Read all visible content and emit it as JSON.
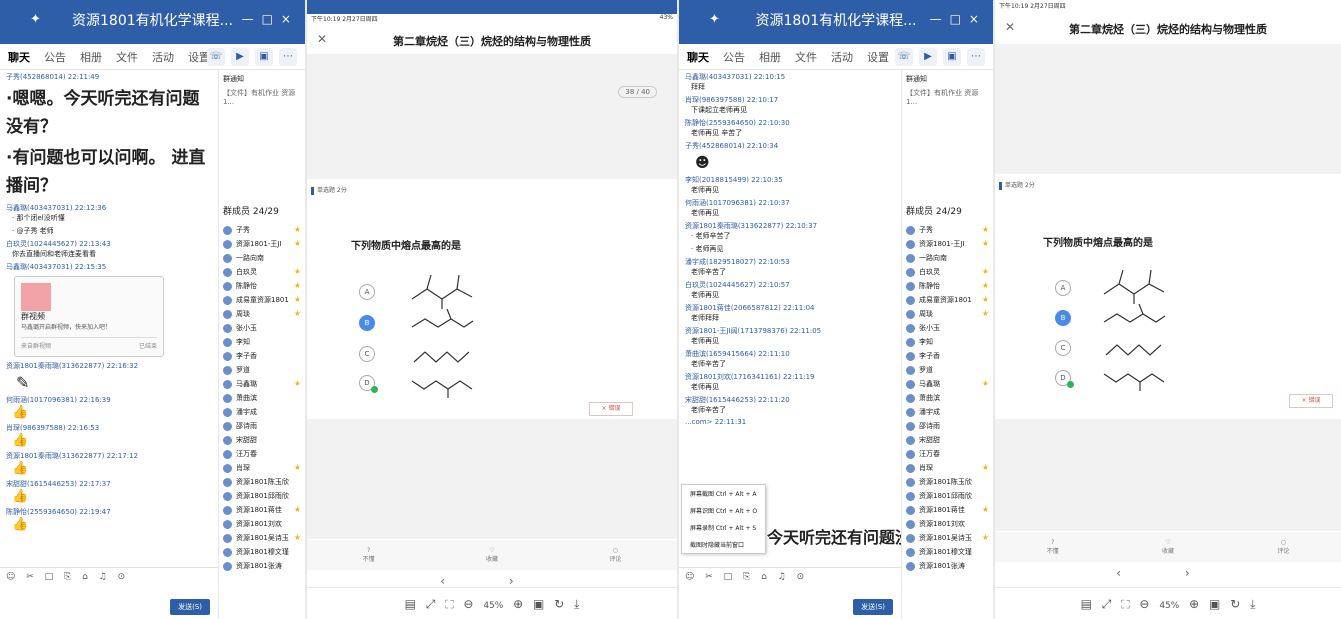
{
  "chat1": {
    "title": "资源1801有机化学课程...",
    "tabs": [
      "聊天",
      "公告",
      "相册",
      "文件",
      "活动",
      "设置"
    ],
    "messages": [
      {
        "meta": "子秀(452868014) 22:11:49",
        "text": ""
      },
      {
        "meta": "",
        "text": "·嗯嗯。今天听完还有问题没有？",
        "big": true
      },
      {
        "meta": "",
        "text": "·有问题也可以问啊。 进直播间？",
        "big": true
      },
      {
        "meta": "马鑫璐(403437031) 22:12:36",
        "text": "· 那个闭el没听懂"
      },
      {
        "meta": "",
        "text": "· @子秀 老师"
      },
      {
        "meta": "白玖灵(1024445627) 22:13:43",
        "text": "你去直播间和老师连麦看看"
      },
      {
        "meta": "马鑫璐(403437031) 22:15:35",
        "text": ""
      }
    ],
    "card": {
      "title": "群视频",
      "desc": "马鑫璐开启群视频，快来加入吧！",
      "source": "来自群视频",
      "state": "已结束"
    },
    "messages2": [
      {
        "meta": "资源1801秦雨璐(313622877) 22:16:32"
      },
      {
        "meta": "何雨涵(1017096381) 22:16:39"
      },
      {
        "meta": "肖琛(986397588) 22:16:53"
      },
      {
        "meta": "资源1801秦雨璐(313622877) 22:17:12"
      },
      {
        "meta": "宋甜甜(1615446253) 22:17:37"
      },
      {
        "meta": "陈静怡(2559364650) 22:19:47"
      }
    ],
    "notice_label": "群通知",
    "notice_file": "【文件】有机作业 资源1...",
    "members_header": "群成员 24/29",
    "members": [
      "子秀",
      "资源1801-王JI",
      "一路向南",
      "白玖灵",
      "陈静怡",
      "成易童资源1801",
      "周琰",
      "张小玉",
      "李知",
      "李子香",
      "罗道",
      "马鑫璐",
      "萧曲滨",
      "潘宇成",
      "邵诗雨",
      "宋甜甜",
      "汪万春",
      "肖琛",
      "资源1801陈玉欣",
      "资源1801邱雨欣",
      "资源1801蒋佳",
      "资源1801刘欢",
      "资源1801吴诗玉",
      "资源1801穆文瑾",
      "资源1801张涛"
    ],
    "send_label": "发送(S)"
  },
  "quiz": {
    "status_time": "下午10:19  2月27日周四",
    "status_right": "43%",
    "title": "第二章烷烃（三）烷烃的结构与物理性质",
    "pager": "38 / 40",
    "tag": "单选题 2分",
    "question": "下列物质中熔点最高的是",
    "options": [
      "A",
      "B",
      "C",
      "D"
    ],
    "wrong_label": "× 错误",
    "actions": [
      {
        "icon": "?",
        "label": "不懂"
      },
      {
        "icon": "♡",
        "label": "收藏"
      },
      {
        "icon": "○",
        "label": "评论"
      }
    ],
    "zoom": "45%"
  },
  "chat2": {
    "title": "资源1801有机化学课程...",
    "messages": [
      {
        "meta": "马鑫璐(403437031) 22:10:15",
        "text": "拜拜"
      },
      {
        "meta": "肖琛(986397588) 22:10:17",
        "text": "下课起立老师再见"
      },
      {
        "meta": "陈静怡(2559364650) 22:10:30",
        "text": "老师再见 辛苦了"
      },
      {
        "meta": "子秀(452868014) 22:10:34",
        "text": ""
      },
      {
        "meta": "李知(2018815499) 22:10:35",
        "text": "老师再见"
      },
      {
        "meta": "何雨涵(1017096381) 22:10:37",
        "text": "老师再见"
      },
      {
        "meta": "资源1801秦雨璐(313622877) 22:10:37",
        "text": "· 老师辛苦了"
      },
      {
        "meta": "",
        "text": "· 老师再见"
      },
      {
        "meta": "潘宇成(1829518027) 22:10:53",
        "text": "老师辛苦了"
      },
      {
        "meta": "白玖灵(1024445627) 22:10:57",
        "text": "老师再见"
      },
      {
        "meta": "资源1801蒋佳(2066587812) 22:11:04",
        "text": "老师拜拜"
      },
      {
        "meta": "资源1801-王JI阔(1713798376) 22:11:05",
        "text": "老师再见"
      },
      {
        "meta": "萧曲滨(1659415664) 22:11:10",
        "text": "老师辛苦了"
      },
      {
        "meta": "资源1801刘欢(1716341161) 22:11:19",
        "text": "老师再见"
      },
      {
        "meta": "宋甜甜(1615446253) 22:11:20",
        "text": "老师辛苦了"
      },
      {
        "meta": "...com> 22:11:31",
        "text": ""
      }
    ],
    "ctx_menu": [
      "屏幕截图 Ctrl + Alt + A",
      "屏幕识图 Ctrl + Alt + O",
      "屏幕录制 Ctrl + Alt + S",
      "截图时隐藏当前窗口"
    ],
    "overlay_text": "今天听完还有问题没",
    "send_label": "发送(S)"
  },
  "quiz2": {
    "status_time": "下午10:19  2月27日周四",
    "title": "第二章烷烃（三）烷烃的结构与物理性质",
    "tag": "单选题 2分",
    "question": "下列物质中熔点最高的是",
    "wrong_label": "× 错误",
    "actions": [
      {
        "icon": "?",
        "label": "不懂"
      },
      {
        "icon": "♡",
        "label": "收藏"
      },
      {
        "icon": "○",
        "label": "评论"
      }
    ],
    "zoom": "45%"
  }
}
